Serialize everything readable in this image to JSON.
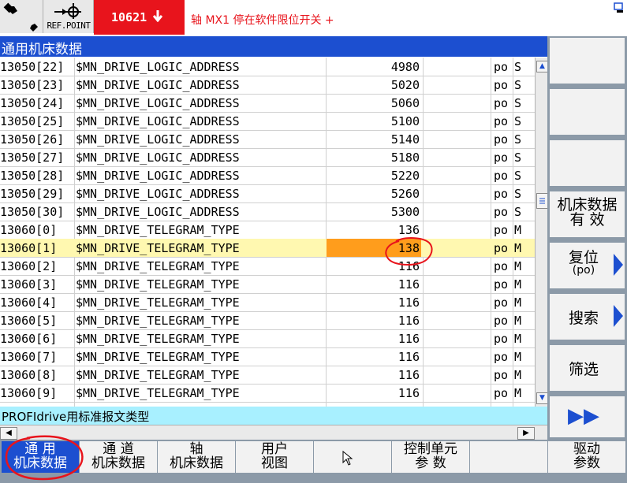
{
  "header": {
    "ref_point_label": "REF.POINT",
    "alarm_number": "10621",
    "alarm_message": "轴 MX1 停在软件限位开关 +"
  },
  "title": "通用机床数据",
  "rows": [
    {
      "id": "13050[22]",
      "name": "$MN_DRIVE_LOGIC_ADDRESS",
      "value": "4980",
      "effect": "po",
      "unit": "S"
    },
    {
      "id": "13050[23]",
      "name": "$MN_DRIVE_LOGIC_ADDRESS",
      "value": "5020",
      "effect": "po",
      "unit": "S"
    },
    {
      "id": "13050[24]",
      "name": "$MN_DRIVE_LOGIC_ADDRESS",
      "value": "5060",
      "effect": "po",
      "unit": "S"
    },
    {
      "id": "13050[25]",
      "name": "$MN_DRIVE_LOGIC_ADDRESS",
      "value": "5100",
      "effect": "po",
      "unit": "S"
    },
    {
      "id": "13050[26]",
      "name": "$MN_DRIVE_LOGIC_ADDRESS",
      "value": "5140",
      "effect": "po",
      "unit": "S"
    },
    {
      "id": "13050[27]",
      "name": "$MN_DRIVE_LOGIC_ADDRESS",
      "value": "5180",
      "effect": "po",
      "unit": "S"
    },
    {
      "id": "13050[28]",
      "name": "$MN_DRIVE_LOGIC_ADDRESS",
      "value": "5220",
      "effect": "po",
      "unit": "S"
    },
    {
      "id": "13050[29]",
      "name": "$MN_DRIVE_LOGIC_ADDRESS",
      "value": "5260",
      "effect": "po",
      "unit": "S"
    },
    {
      "id": "13050[30]",
      "name": "$MN_DRIVE_LOGIC_ADDRESS",
      "value": "5300",
      "effect": "po",
      "unit": "S"
    },
    {
      "id": "13060[0]",
      "name": "$MN_DRIVE_TELEGRAM_TYPE",
      "value": "136",
      "effect": "po",
      "unit": "M"
    },
    {
      "id": "13060[1]",
      "name": "$MN_DRIVE_TELEGRAM_TYPE",
      "value": "138",
      "effect": "po",
      "unit": "M"
    },
    {
      "id": "13060[2]",
      "name": "$MN_DRIVE_TELEGRAM_TYPE",
      "value": "116",
      "effect": "po",
      "unit": "M"
    },
    {
      "id": "13060[3]",
      "name": "$MN_DRIVE_TELEGRAM_TYPE",
      "value": "116",
      "effect": "po",
      "unit": "M"
    },
    {
      "id": "13060[4]",
      "name": "$MN_DRIVE_TELEGRAM_TYPE",
      "value": "116",
      "effect": "po",
      "unit": "M"
    },
    {
      "id": "13060[5]",
      "name": "$MN_DRIVE_TELEGRAM_TYPE",
      "value": "116",
      "effect": "po",
      "unit": "M"
    },
    {
      "id": "13060[6]",
      "name": "$MN_DRIVE_TELEGRAM_TYPE",
      "value": "116",
      "effect": "po",
      "unit": "M"
    },
    {
      "id": "13060[7]",
      "name": "$MN_DRIVE_TELEGRAM_TYPE",
      "value": "116",
      "effect": "po",
      "unit": "M"
    },
    {
      "id": "13060[8]",
      "name": "$MN_DRIVE_TELEGRAM_TYPE",
      "value": "116",
      "effect": "po",
      "unit": "M"
    },
    {
      "id": "13060[9]",
      "name": "$MN_DRIVE_TELEGRAM_TYPE",
      "value": "116",
      "effect": "po",
      "unit": "M"
    }
  ],
  "selected_row": 10,
  "description": "PROFIdrive用标准报文类型",
  "vertical_softkeys": {
    "machine_data_active_1": "机床数据",
    "machine_data_active_2": "有  效",
    "reset_1": "复位",
    "reset_2": "(po)",
    "search": "搜索",
    "filter": "筛选",
    "more": "▶▶"
  },
  "horizontal_softkeys": [
    {
      "line1": "通  用",
      "line2": "机床数据",
      "active": true
    },
    {
      "line1": "通  道",
      "line2": "机床数据",
      "active": false
    },
    {
      "line1": "轴",
      "line2": "机床数据",
      "active": false
    },
    {
      "line1": "用户",
      "line2": "视图",
      "active": false
    },
    {
      "line1": "",
      "line2": "",
      "active": false
    },
    {
      "line1": "控制单元",
      "line2": "参  数",
      "active": false
    },
    {
      "line1": "",
      "line2": "",
      "active": false
    },
    {
      "line1": "驱动",
      "line2": "参数",
      "active": false
    }
  ],
  "colors": {
    "title_bar": "#1c4fd0",
    "alarm_bg": "#e8141c",
    "selected_row": "#fff8b0",
    "edit_cell": "#ff9d1c",
    "hint_bar": "#a8f0ff",
    "annotation": "#e8141c"
  },
  "icons": {
    "wrench": "wrench-icon",
    "ref_point": "ref-point-icon",
    "alarm_arrow": "arrow-down-icon",
    "corner": "window-icon",
    "scroll_up": "chevron-up-icon",
    "scroll_down": "chevron-down-icon",
    "scroll_left": "chevron-left-icon",
    "scroll_right": "chevron-right-icon",
    "cursor": "mouse-pointer-icon"
  }
}
